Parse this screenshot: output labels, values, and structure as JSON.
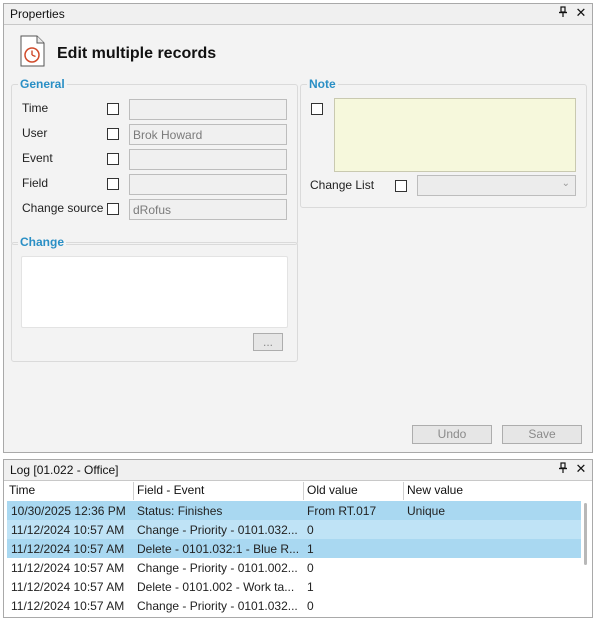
{
  "properties_panel": {
    "title": "Properties",
    "pin_glyph": "❒",
    "close_glyph": "✕",
    "header_title": "Edit multiple records",
    "general": {
      "legend": "General",
      "fields": [
        {
          "label": "Time",
          "value": ""
        },
        {
          "label": "User",
          "value": "Brok Howard"
        },
        {
          "label": "Event",
          "value": ""
        },
        {
          "label": "Field",
          "value": ""
        },
        {
          "label": "Change source",
          "value": "dRofus"
        }
      ]
    },
    "note": {
      "legend": "Note",
      "change_list_label": "Change List",
      "dropdown_arrow": "⌄"
    },
    "change": {
      "legend": "Change",
      "ellipsis_label": "..."
    },
    "undo_label": "Undo",
    "save_label": "Save"
  },
  "log_panel": {
    "title": "Log [01.022 - Office]",
    "columns": [
      "Time",
      "Field - Event",
      "Old value",
      "New value"
    ],
    "rows": [
      {
        "time": "10/30/2025 12:36 PM",
        "field_event": "Status: Finishes",
        "old": "From RT.017",
        "new": "Unique",
        "state": "selected"
      },
      {
        "time": "11/12/2024 10:57 AM",
        "field_event": "Change - Priority - 0101.032...",
        "old": "0",
        "new": "",
        "state": "selected"
      },
      {
        "time": "11/12/2024 10:57 AM",
        "field_event": "Delete - 0101.032:1 - Blue R...",
        "old": "1",
        "new": "",
        "state": "selected"
      },
      {
        "time": "11/12/2024 10:57 AM",
        "field_event": "Change - Priority - 0101.002...",
        "old": "0",
        "new": "",
        "state": "normal"
      },
      {
        "time": "11/12/2024 10:57 AM",
        "field_event": "Delete - 0101.002 - Work ta...",
        "old": "1",
        "new": "",
        "state": "normal"
      },
      {
        "time": "11/12/2024 10:57 AM",
        "field_event": "Change - Priority - 0101.032...",
        "old": "0",
        "new": "",
        "state": "normal"
      }
    ]
  },
  "colors": {
    "accent": "#2a8fc5",
    "selection": "#a9d8f1",
    "note_background": "#f6f8dc"
  }
}
